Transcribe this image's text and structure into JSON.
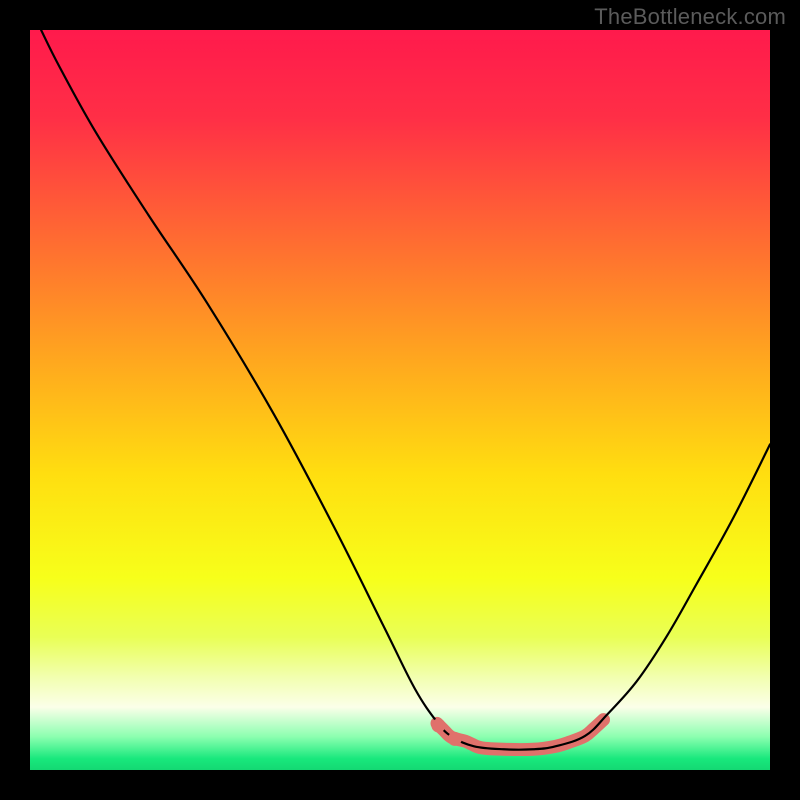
{
  "watermark": "TheBottleneck.com",
  "chart_data": {
    "type": "line",
    "title": "",
    "xlabel": "",
    "ylabel": "",
    "xlim": [
      0,
      100
    ],
    "ylim": [
      0,
      100
    ],
    "grid": false,
    "legend": false,
    "background_gradient": {
      "stops": [
        {
          "offset": 0.0,
          "color": "#ff1a4c"
        },
        {
          "offset": 0.12,
          "color": "#ff2f46"
        },
        {
          "offset": 0.28,
          "color": "#ff6a32"
        },
        {
          "offset": 0.44,
          "color": "#ffa51f"
        },
        {
          "offset": 0.6,
          "color": "#ffde10"
        },
        {
          "offset": 0.74,
          "color": "#f7ff1a"
        },
        {
          "offset": 0.82,
          "color": "#e9ff55"
        },
        {
          "offset": 0.875,
          "color": "#f2ffb0"
        },
        {
          "offset": 0.915,
          "color": "#fbffe9"
        },
        {
          "offset": 0.955,
          "color": "#8cffb0"
        },
        {
          "offset": 0.985,
          "color": "#18e87c"
        },
        {
          "offset": 1.0,
          "color": "#14d873"
        }
      ]
    },
    "series": [
      {
        "name": "curve-main",
        "color": "#000000",
        "width": 2.2,
        "points": [
          {
            "x": 1.5,
            "y": 100
          },
          {
            "x": 4,
            "y": 95
          },
          {
            "x": 9,
            "y": 86
          },
          {
            "x": 16,
            "y": 75
          },
          {
            "x": 24,
            "y": 63
          },
          {
            "x": 33,
            "y": 48
          },
          {
            "x": 41,
            "y": 33
          },
          {
            "x": 48,
            "y": 19
          },
          {
            "x": 52,
            "y": 11
          },
          {
            "x": 55,
            "y": 6.5
          },
          {
            "x": 57,
            "y": 4.5
          },
          {
            "x": 60,
            "y": 3.2
          },
          {
            "x": 64,
            "y": 2.8
          },
          {
            "x": 68,
            "y": 2.8
          },
          {
            "x": 71,
            "y": 3.2
          },
          {
            "x": 75,
            "y": 4.6
          },
          {
            "x": 78,
            "y": 7.5
          },
          {
            "x": 82,
            "y": 12
          },
          {
            "x": 86,
            "y": 18
          },
          {
            "x": 90,
            "y": 25
          },
          {
            "x": 95,
            "y": 34
          },
          {
            "x": 100,
            "y": 44
          }
        ]
      },
      {
        "name": "highlight-floor",
        "color": "#e0716b",
        "width": 13,
        "points": [
          {
            "x": 55.0,
            "y": 6.3
          },
          {
            "x": 55.9,
            "y": 5.4
          },
          {
            "x": 57.0,
            "y": 4.4
          },
          {
            "x": 58.8,
            "y": 3.9
          },
          {
            "x": 59.7,
            "y": 3.5
          },
          {
            "x": 61.0,
            "y": 3.0
          },
          {
            "x": 64.0,
            "y": 2.8
          },
          {
            "x": 68.0,
            "y": 2.8
          },
          {
            "x": 71.0,
            "y": 3.2
          },
          {
            "x": 73.0,
            "y": 3.8
          },
          {
            "x": 75.0,
            "y": 4.6
          },
          {
            "x": 76.2,
            "y": 5.6
          },
          {
            "x": 77.5,
            "y": 6.8
          }
        ]
      },
      {
        "name": "highlight-dots",
        "color": "#e0716b",
        "type": "scatter",
        "radius": 7,
        "points": [
          {
            "x": 55.2,
            "y": 6.0
          },
          {
            "x": 57.4,
            "y": 4.2
          }
        ]
      }
    ]
  }
}
